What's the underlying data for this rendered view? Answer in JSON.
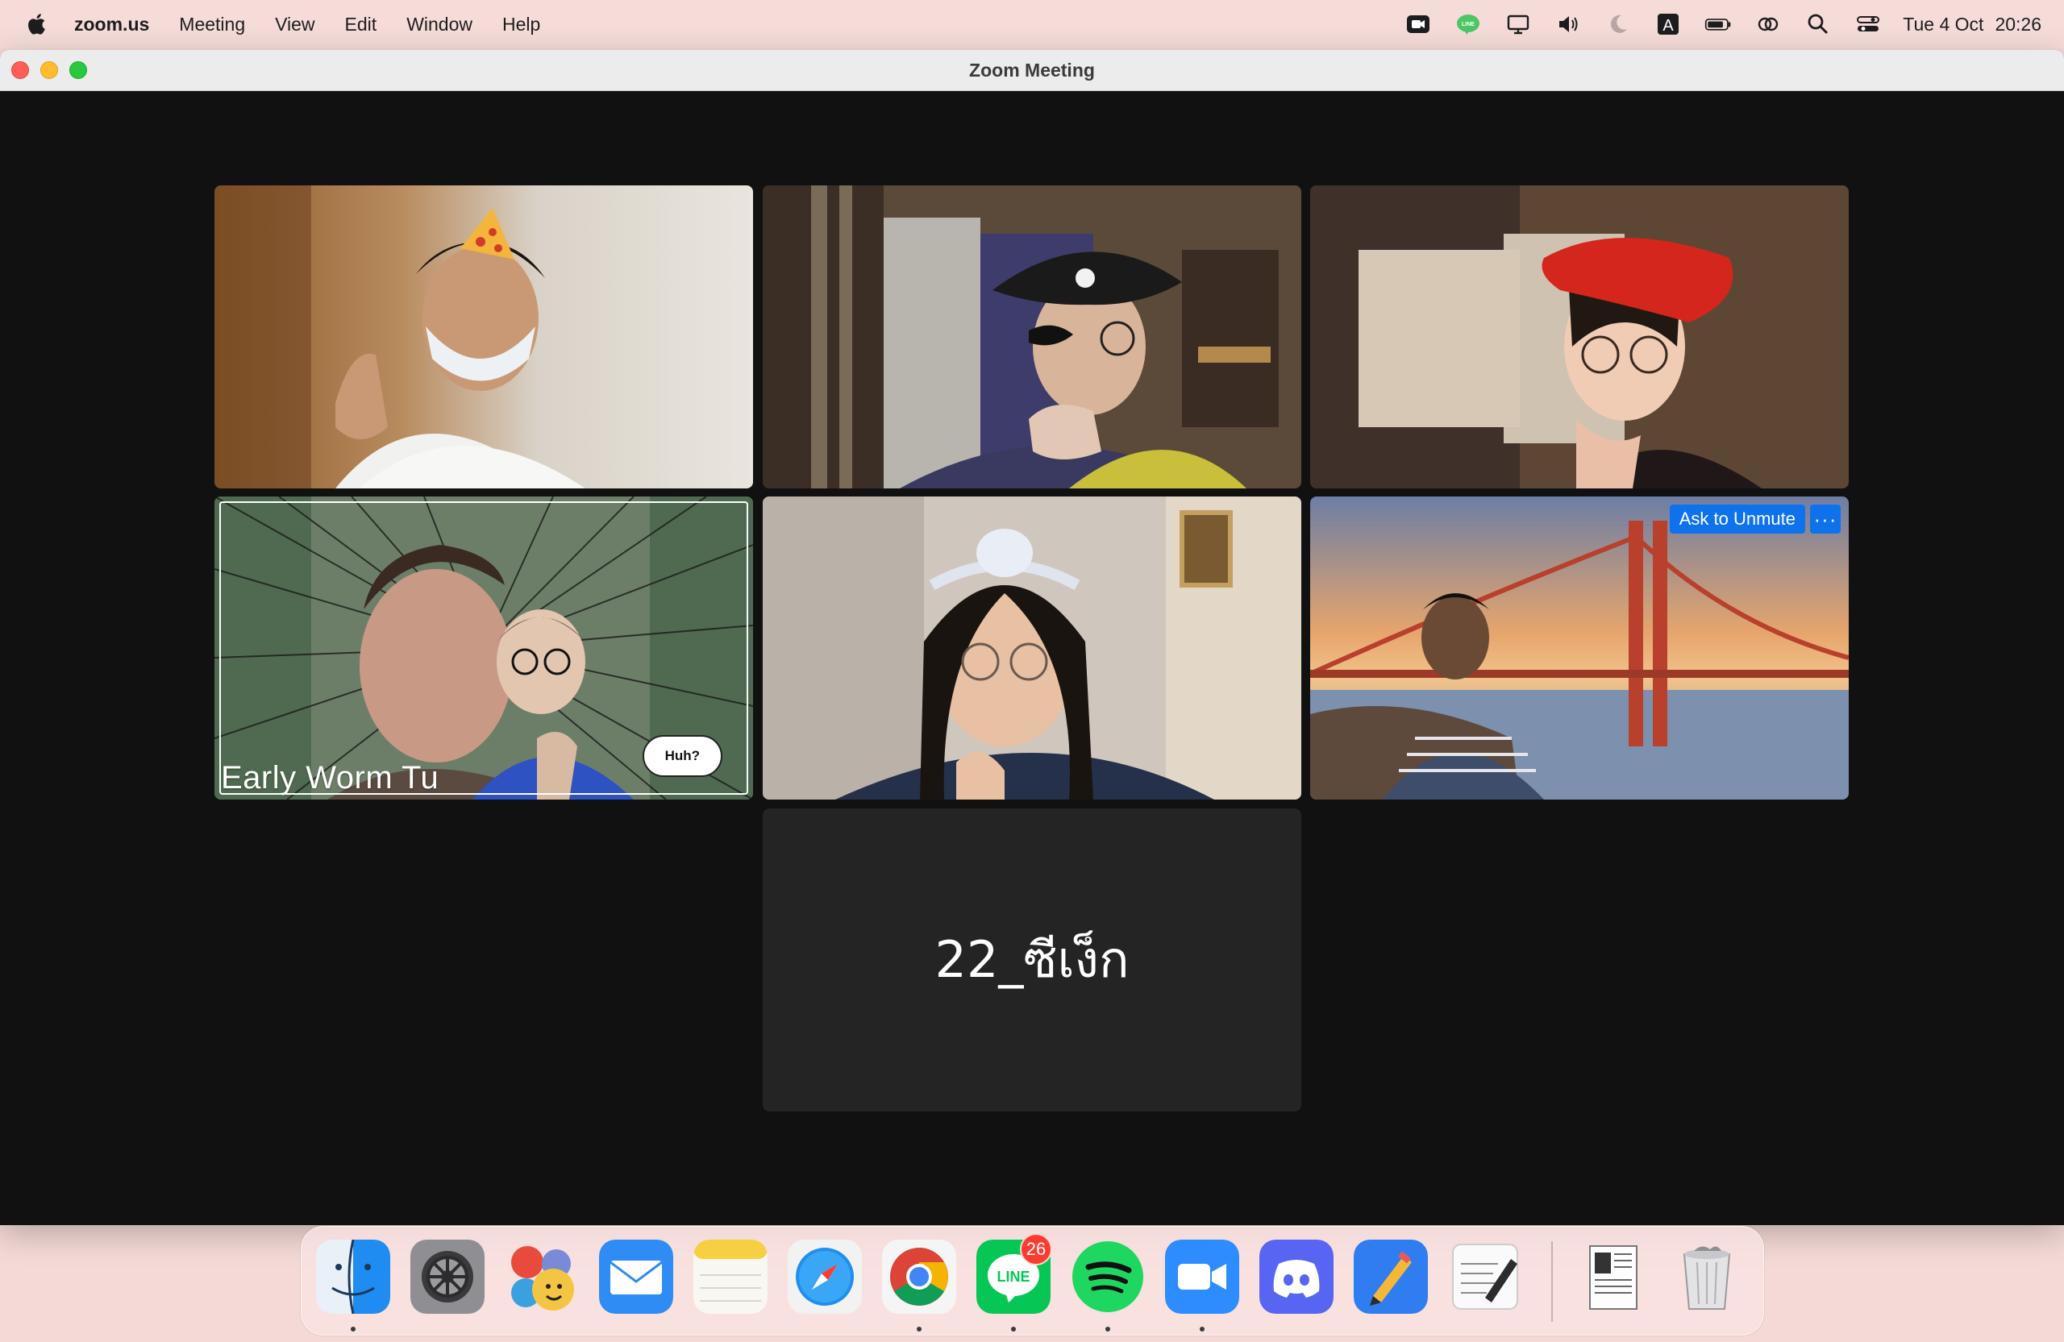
{
  "menubar": {
    "app_name": "zoom.us",
    "menus": [
      "Meeting",
      "View",
      "Edit",
      "Window",
      "Help"
    ],
    "date": "Tue 4 Oct",
    "time": "20:26"
  },
  "window": {
    "title": "Zoom Meeting"
  },
  "participants": [
    {
      "name": "",
      "video": "pizza-hat"
    },
    {
      "name": "",
      "video": "pirate-hat"
    },
    {
      "name": "",
      "video": "red-beret"
    },
    {
      "name": "Early Worm Tu",
      "video": "speaker-active",
      "speech_bubble": "Huh?"
    },
    {
      "name": "",
      "video": "headband"
    },
    {
      "name": "",
      "video": "golden-gate",
      "ask_unmute_label": "Ask to Unmute",
      "more_label": "···"
    },
    {
      "name": "22_ซีเง็ก",
      "video": "off"
    }
  ],
  "dock": {
    "apps": [
      "Finder",
      "System Settings",
      "Launchpad",
      "Mail",
      "Notes",
      "Safari",
      "Google Chrome",
      "LINE",
      "Spotify",
      "Zoom",
      "Discord",
      "Pages",
      "TextEdit"
    ],
    "line_badge": "26"
  },
  "colors": {
    "active_speaker": "#63d56a",
    "unmute_button": "#0e72ed",
    "menubar": "#f6dcd9",
    "meeting_bg": "#111111"
  }
}
